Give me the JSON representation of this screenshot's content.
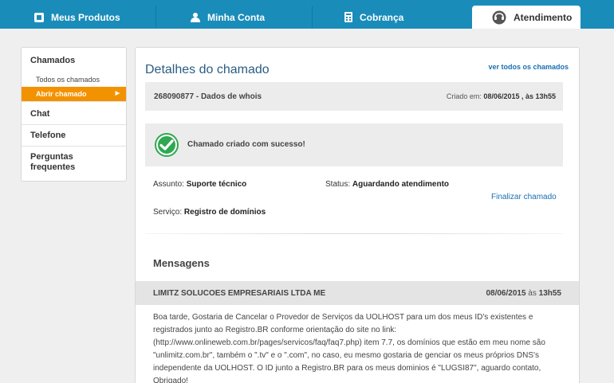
{
  "nav": {
    "tabs": [
      {
        "label": "Meus Produtos",
        "icon": "products-icon"
      },
      {
        "label": "Minha Conta",
        "icon": "user-icon"
      },
      {
        "label": "Cobrança",
        "icon": "calculator-icon"
      },
      {
        "label": "Atendimento",
        "icon": "support-icon",
        "active": true
      }
    ]
  },
  "sidebar": {
    "chamados": "Chamados",
    "todos": "Todos os chamados",
    "abrir": "Abrir chamado",
    "chat": "Chat",
    "telefone": "Telefone",
    "faq": "Perguntas frequentes"
  },
  "main": {
    "title": "Detalhes do chamado",
    "all_link": "ver todos os chamados",
    "ticket_id": "268090877 - Dados de whois",
    "created_label": "Criado em:",
    "created_date": "08/06/2015 , às 13h55",
    "success_msg": "Chamado criado com sucesso!",
    "assunto_label": "Assunto:",
    "assunto_value": "Suporte técnico",
    "status_label": "Status:",
    "status_value": "Aguardando atendimento",
    "servico_label": "Serviço:",
    "servico_value": "Registro de domínios",
    "finalizar": "Finalizar chamado",
    "messages_title": "Mensagens"
  },
  "message": {
    "sender": "LIMITZ SOLUCOES EMPRESARIAIS LTDA ME",
    "date": "08/06/2015",
    "time_sep": "às",
    "time": "13h55",
    "body": "Boa tarde, Gostaria de Cancelar o Provedor de Serviços da UOLHOST para um dos meus ID's existentes e registrados junto ao Registro.BR conforme orientação do site no link: (http://www.onlineweb.com.br/pages/servicos/faq/faq7.php) item 7.7, os domínios que estão em meu nome são \"unlimitz.com.br\", também o \".tv\" e o \".com\", no caso, eu mesmo gostaria de genciar os meus próprios DNS's independente da UOLHOST. O ID junto a Registro.BR para os meus dominios é \"LUGSI87\", aguardo contato, Obrigado!"
  },
  "colors": {
    "nav_bg": "#1a8cba",
    "accent": "#f39200",
    "title": "#2a5d84",
    "link": "#1a6fb3",
    "success": "#2fa84f"
  }
}
